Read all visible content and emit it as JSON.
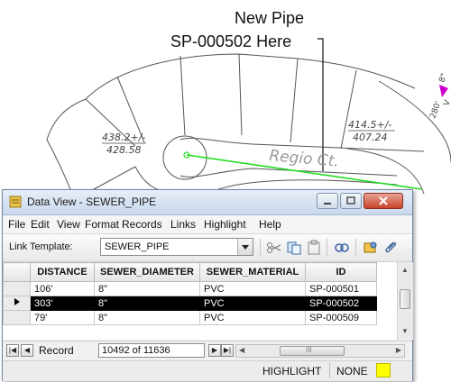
{
  "map": {
    "callout_line1": "New Pipe",
    "callout_line2": "SP-000502 Here",
    "street_label": "Regio Ct.",
    "lot_left_line1": "438.2+/-",
    "lot_left_line2": "428.58",
    "lot_right_line1": "414.5+/-",
    "lot_right_line2": "407.24",
    "edge_label_1": "280'",
    "edge_label_2": "8\"",
    "edge_label_3": "V",
    "pipe_color": "#22dd22",
    "marker_color": "#cc00cc"
  },
  "window": {
    "title": "Data View - SEWER_PIPE",
    "menu": [
      "File",
      "Edit",
      "View",
      "Format",
      "Records",
      "Links",
      "Highlight",
      "Help"
    ],
    "link_template_label": "Link Template:",
    "link_template_value": "SEWER_PIPE",
    "columns": [
      "DISTANCE",
      "SEWER_DIAMETER",
      "SEWER_MATERIAL",
      "ID"
    ],
    "rows": [
      {
        "DISTANCE": "106'",
        "SEWER_DIAMETER": "8\"",
        "SEWER_MATERIAL": "PVC",
        "ID": "SP-000501"
      },
      {
        "DISTANCE": "303'",
        "SEWER_DIAMETER": "8\"",
        "SEWER_MATERIAL": "PVC",
        "ID": "SP-000502"
      },
      {
        "DISTANCE": "79'",
        "SEWER_DIAMETER": "8\"",
        "SEWER_MATERIAL": "PVC",
        "ID": "SP-000509"
      }
    ],
    "selected_row_index": 1,
    "nav_record_label": "Record",
    "nav_record_value": "10492 of 11636",
    "hscroll_grip": "III",
    "status_highlight_label": "HIGHLIGHT",
    "status_highlight_value": "NONE",
    "status_highlight_color": "#ffff00"
  }
}
